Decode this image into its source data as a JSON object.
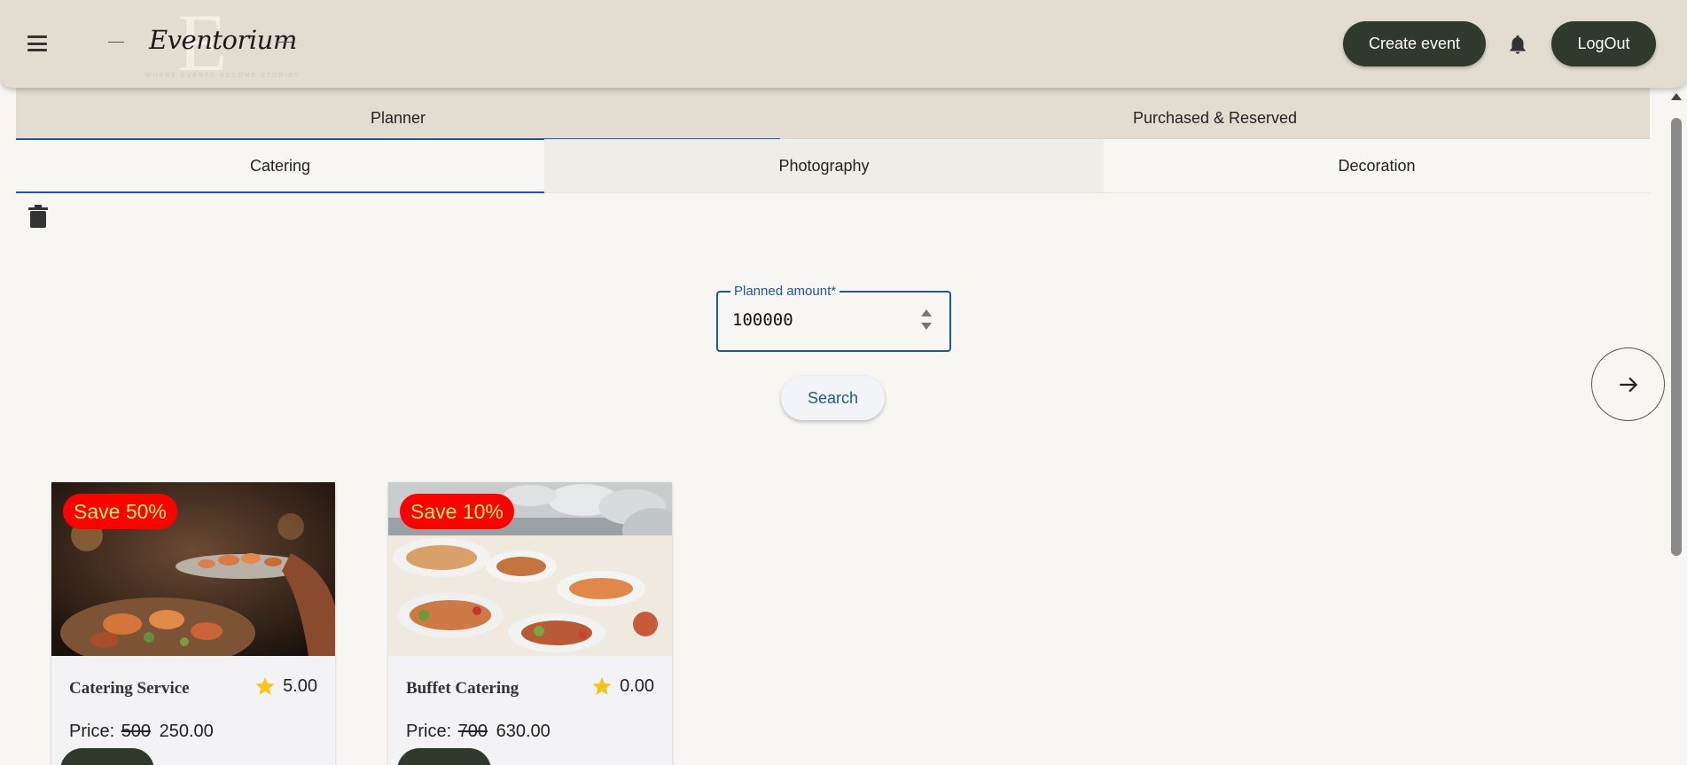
{
  "app": {
    "brand": "Eventorium",
    "brand_initial": "E",
    "tagline": "WHERE EVENTS BECOME STORIES"
  },
  "header": {
    "menu_icon": "hamburger-menu-icon",
    "create_event_label": "Create event",
    "notifications_icon": "bell-icon",
    "logout_label": "LogOut"
  },
  "tabs": [
    {
      "label": "Planner",
      "active": true
    },
    {
      "label": "Purchased & Reserved",
      "active": false
    }
  ],
  "subtabs": [
    {
      "label": "Catering",
      "active": true
    },
    {
      "label": "Photography",
      "active": false
    },
    {
      "label": "Decoration",
      "active": false
    }
  ],
  "planner": {
    "delete_icon": "trash-icon",
    "amount_label": "Planned amount*",
    "amount_value": "100000",
    "search_label": "Search",
    "next_icon": "arrow-right-icon"
  },
  "cards": [
    {
      "badge": "Save 50%",
      "title": "Catering Service",
      "rating": "5.00",
      "price_label": "Price:",
      "old_price": "500",
      "new_price": "250.00"
    },
    {
      "badge": "Save 10%",
      "title": "Buffet Catering",
      "rating": "0.00",
      "price_label": "Price:",
      "old_price": "700",
      "new_price": "630.00"
    }
  ],
  "colors": {
    "header_bg": "#e3ddd1",
    "primary_dark": "#2f3a2c",
    "accent_blue": "#1f56a8",
    "badge_bg": "#ff0000",
    "badge_text": "#fff36b",
    "star": "#f5c518"
  }
}
